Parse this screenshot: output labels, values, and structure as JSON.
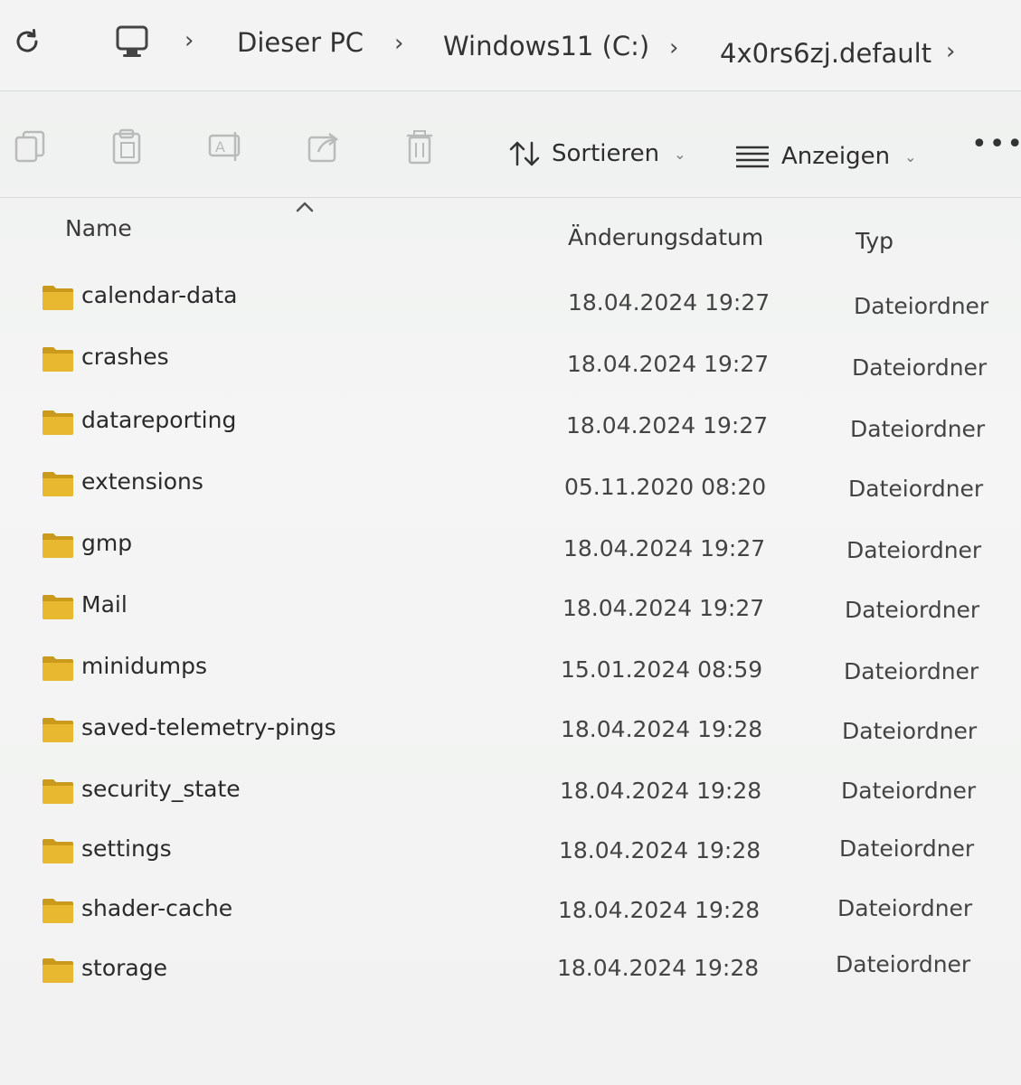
{
  "breadcrumb": {
    "items": [
      "Dieser PC",
      "Windows11 (C:)",
      "4x0rs6zj.default"
    ]
  },
  "toolbar": {
    "sort_label": "Sortieren",
    "view_label": "Anzeigen"
  },
  "columns": {
    "name": "Name",
    "date": "Änderungsdatum",
    "type": "Typ"
  },
  "rows": [
    {
      "name": "calendar-data",
      "date": "18.04.2024 19:27",
      "type": "Dateiordner"
    },
    {
      "name": "crashes",
      "date": "18.04.2024 19:27",
      "type": "Dateiordner"
    },
    {
      "name": "datareporting",
      "date": "18.04.2024 19:27",
      "type": "Dateiordner"
    },
    {
      "name": "extensions",
      "date": "05.11.2020 08:20",
      "type": "Dateiordner"
    },
    {
      "name": "gmp",
      "date": "18.04.2024 19:27",
      "type": "Dateiordner"
    },
    {
      "name": "Mail",
      "date": "18.04.2024 19:27",
      "type": "Dateiordner"
    },
    {
      "name": "minidumps",
      "date": "15.01.2024 08:59",
      "type": "Dateiordner"
    },
    {
      "name": "saved-telemetry-pings",
      "date": "18.04.2024 19:28",
      "type": "Dateiordner"
    },
    {
      "name": "security_state",
      "date": "18.04.2024 19:28",
      "type": "Dateiordner"
    },
    {
      "name": "settings",
      "date": "18.04.2024 19:28",
      "type": "Dateiordner"
    },
    {
      "name": "shader-cache",
      "date": "18.04.2024 19:28",
      "type": "Dateiordner"
    },
    {
      "name": "storage",
      "date": "18.04.2024 19:28",
      "type": "Dateiordner"
    }
  ],
  "colors": {
    "folder": "#e8b830",
    "folder_dark": "#c99a1c"
  }
}
